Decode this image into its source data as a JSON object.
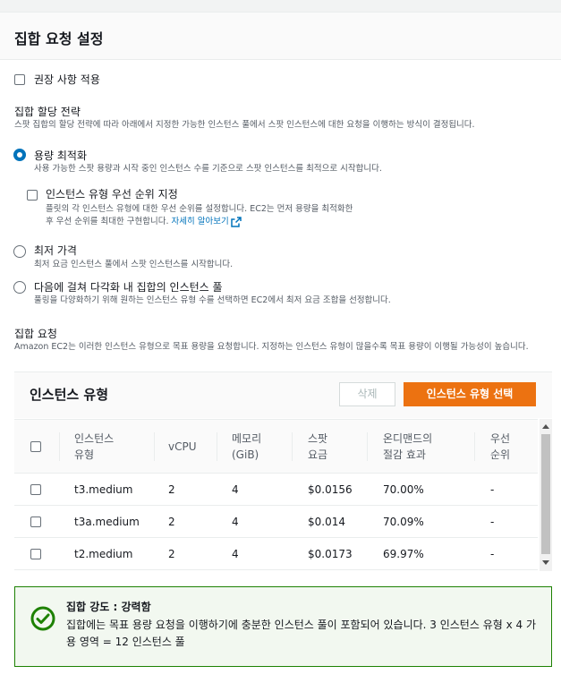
{
  "header": {
    "title": "집합 요청 설정"
  },
  "recommendation": {
    "label": "권장 사항 적용"
  },
  "allocation": {
    "title": "집합 할당 전략",
    "description": "스팟 집합의 할당 전략에 따라 아래에서 지정한 가능한 인스턴스 풀에서 스팟 인스턴스에 대한 요청을 이행하는 방식이 결정됩니다.",
    "options": [
      {
        "label": "용량 최적화",
        "description": "사용 가능한 스팟 용량과 시작 중인 인스턴스 수를 기준으로 스팟 인스턴스를 최적으로 시작합니다.",
        "selected": true
      },
      {
        "label": "최저 가격",
        "description": "최저 요금 인스턴스 풀에서 스팟 인스턴스를 시작합니다.",
        "selected": false
      },
      {
        "label": "다음에 걸쳐 다각화 내 집합의 인스턴스 풀",
        "description": "풀링을 다양화하기 위해 원하는 인스턴스 유형 수를 선택하면 EC2에서 최저 요금 조합을 선정합니다.",
        "selected": false
      }
    ],
    "priority": {
      "label": "인스턴스 유형 우선 순위 지정",
      "description_line1": "플릿의 각 인스턴스 유형에 대한 우선 순위를 설정합니다. EC2는 먼저 용량을 최적화한",
      "description_line2": "후 우선 순위를 최대한 구현합니다.",
      "link": "자세히 알아보기"
    }
  },
  "fleet_request": {
    "title": "집합 요청",
    "description": "Amazon EC2는 이러한 인스턴스 유형으로 목표 용량을 요청합니다. 지정하는 인스턴스 유형이 많을수록 목표 용량이 이행될 가능성이 높습니다."
  },
  "panel": {
    "title": "인스턴스 유형",
    "delete_label": "삭제",
    "select_label": "인스턴스 유형 선택",
    "columns": [
      {
        "line1": "인스턴스",
        "line2": "유형"
      },
      {
        "line1": "vCPU",
        "line2": ""
      },
      {
        "line1": "메모리",
        "line2": "(GiB)"
      },
      {
        "line1": "스팟",
        "line2": "요금"
      },
      {
        "line1": "온디맨드의",
        "line2": "절감 효과"
      },
      {
        "line1": "우선",
        "line2": "순위"
      }
    ],
    "rows": [
      {
        "type": "t3.medium",
        "vcpu": "2",
        "memory": "4",
        "spot": "$0.0156",
        "savings": "70.00%",
        "priority": "-"
      },
      {
        "type": "t3a.medium",
        "vcpu": "2",
        "memory": "4",
        "spot": "$0.014",
        "savings": "70.09%",
        "priority": "-"
      },
      {
        "type": "t2.medium",
        "vcpu": "2",
        "memory": "4",
        "spot": "$0.0173",
        "savings": "69.97%",
        "priority": "-"
      }
    ]
  },
  "alert": {
    "title": "집합 강도 : 강력함",
    "text": "집합에는 목표 용량 요청을 이행하기에 충분한 인스턴스 풀이 포함되어 있습니다. 3 인스턴스 유형 x 4 가용 영역 = 12 인스턴스 풀"
  },
  "colors": {
    "accent": "#0073bb",
    "primary_button": "#ec7211",
    "success": "#1d8102"
  }
}
